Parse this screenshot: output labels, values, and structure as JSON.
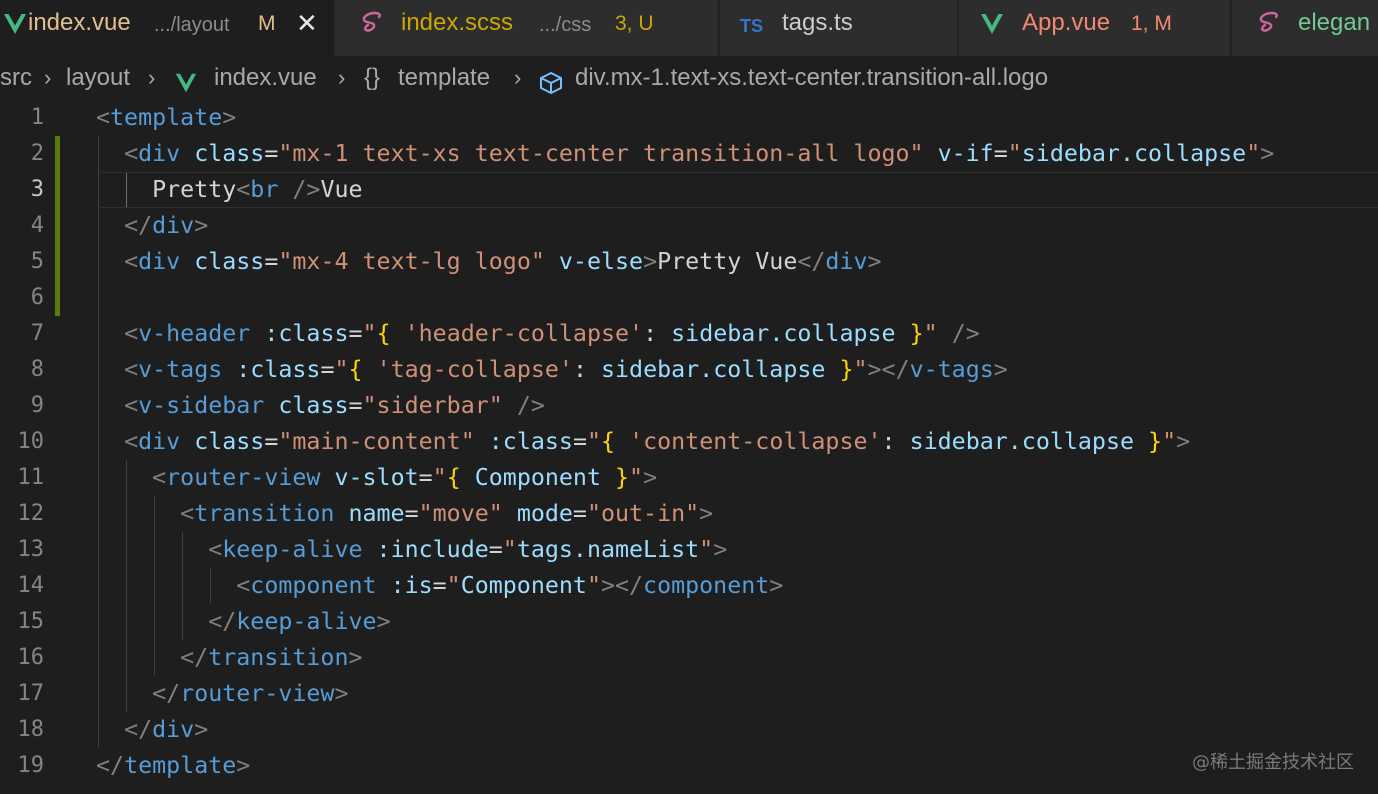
{
  "tabs": [
    {
      "name": "index.vue",
      "desc": ".../layout",
      "status": "M",
      "icon": "vue-icon",
      "active": true,
      "close": "✕",
      "name_color": "#e2c08d",
      "status_color": "#e2c08d"
    },
    {
      "name": "index.scss",
      "desc": ".../css",
      "status": "3, U",
      "icon": "sass-icon",
      "active": false,
      "name_color": "#cca700",
      "status_color": "#cca700"
    },
    {
      "name": "tags.ts",
      "desc": "",
      "status": "",
      "icon": "typescript-icon",
      "icon_text": "TS",
      "active": false,
      "name_color": "#cccccc"
    },
    {
      "name": "App.vue",
      "desc": "",
      "status": "1, M",
      "icon": "vue-icon",
      "active": false,
      "name_color": "#f48771",
      "status_color": "#f48771"
    },
    {
      "name": "elegan",
      "desc": "",
      "status": "",
      "icon": "sass-icon",
      "active": false,
      "name_color": "#73c991"
    }
  ],
  "breadcrumb": {
    "items": [
      "src",
      "layout",
      "index.vue",
      "template",
      "div.mx-1.text-xs.text-center.transition-all.logo"
    ],
    "template_icon": "{}",
    "separator": "›"
  },
  "editor": {
    "current_line": 3,
    "lines": [
      {
        "n": "1",
        "tokens": [
          [
            "t-punc",
            "<"
          ],
          [
            "t-tag",
            "template"
          ],
          [
            "t-punc",
            ">"
          ]
        ]
      },
      {
        "n": "2",
        "tokens": [
          [
            "t-text",
            "  "
          ],
          [
            "t-punc",
            "<"
          ],
          [
            "t-tag",
            "div"
          ],
          [
            "t-text",
            " "
          ],
          [
            "t-attr",
            "class"
          ],
          [
            "t-text",
            "="
          ],
          [
            "t-str",
            "\"mx-1 text-xs text-center transition-all logo\""
          ],
          [
            "t-text",
            " "
          ],
          [
            "t-attr",
            "v-if"
          ],
          [
            "t-text",
            "="
          ],
          [
            "t-str",
            "\""
          ],
          [
            "t-attr",
            "sidebar.collapse"
          ],
          [
            "t-str",
            "\""
          ],
          [
            "t-punc",
            ">"
          ]
        ]
      },
      {
        "n": "3",
        "tokens": [
          [
            "t-text",
            "    Pretty"
          ],
          [
            "t-punc",
            "<"
          ],
          [
            "t-tag",
            "br"
          ],
          [
            "t-text",
            " "
          ],
          [
            "t-punc",
            "/>"
          ],
          [
            "t-text",
            "Vue"
          ]
        ]
      },
      {
        "n": "4",
        "tokens": [
          [
            "t-text",
            "  "
          ],
          [
            "t-punc",
            "</"
          ],
          [
            "t-tag",
            "div"
          ],
          [
            "t-punc",
            ">"
          ]
        ]
      },
      {
        "n": "5",
        "tokens": [
          [
            "t-text",
            "  "
          ],
          [
            "t-punc",
            "<"
          ],
          [
            "t-tag",
            "div"
          ],
          [
            "t-text",
            " "
          ],
          [
            "t-attr",
            "class"
          ],
          [
            "t-text",
            "="
          ],
          [
            "t-str",
            "\"mx-4 text-lg logo\""
          ],
          [
            "t-text",
            " "
          ],
          [
            "t-attr",
            "v-else"
          ],
          [
            "t-punc",
            ">"
          ],
          [
            "t-text",
            "Pretty Vue"
          ],
          [
            "t-punc",
            "</"
          ],
          [
            "t-tag",
            "div"
          ],
          [
            "t-punc",
            ">"
          ]
        ]
      },
      {
        "n": "6",
        "tokens": []
      },
      {
        "n": "7",
        "tokens": [
          [
            "t-text",
            "  "
          ],
          [
            "t-punc",
            "<"
          ],
          [
            "t-tag",
            "v-header"
          ],
          [
            "t-text",
            " "
          ],
          [
            "t-attr",
            ":class"
          ],
          [
            "t-text",
            "="
          ],
          [
            "t-str",
            "\""
          ],
          [
            "t-brace",
            "{"
          ],
          [
            "t-text",
            " "
          ],
          [
            "t-str",
            "'header-collapse'"
          ],
          [
            "t-text",
            ": "
          ],
          [
            "t-attr",
            "sidebar.collapse"
          ],
          [
            "t-text",
            " "
          ],
          [
            "t-brace",
            "}"
          ],
          [
            "t-str",
            "\""
          ],
          [
            "t-text",
            " "
          ],
          [
            "t-punc",
            "/>"
          ]
        ]
      },
      {
        "n": "8",
        "tokens": [
          [
            "t-text",
            "  "
          ],
          [
            "t-punc",
            "<"
          ],
          [
            "t-tag",
            "v-tags"
          ],
          [
            "t-text",
            " "
          ],
          [
            "t-attr",
            ":class"
          ],
          [
            "t-text",
            "="
          ],
          [
            "t-str",
            "\""
          ],
          [
            "t-brace",
            "{"
          ],
          [
            "t-text",
            " "
          ],
          [
            "t-str",
            "'tag-collapse'"
          ],
          [
            "t-text",
            ": "
          ],
          [
            "t-attr",
            "sidebar.collapse"
          ],
          [
            "t-text",
            " "
          ],
          [
            "t-brace",
            "}"
          ],
          [
            "t-str",
            "\""
          ],
          [
            "t-punc",
            "></"
          ],
          [
            "t-tag",
            "v-tags"
          ],
          [
            "t-punc",
            ">"
          ]
        ]
      },
      {
        "n": "9",
        "tokens": [
          [
            "t-text",
            "  "
          ],
          [
            "t-punc",
            "<"
          ],
          [
            "t-tag",
            "v-sidebar"
          ],
          [
            "t-text",
            " "
          ],
          [
            "t-attr",
            "class"
          ],
          [
            "t-text",
            "="
          ],
          [
            "t-str",
            "\"siderbar\""
          ],
          [
            "t-text",
            " "
          ],
          [
            "t-punc",
            "/>"
          ]
        ]
      },
      {
        "n": "10",
        "tokens": [
          [
            "t-text",
            "  "
          ],
          [
            "t-punc",
            "<"
          ],
          [
            "t-tag",
            "div"
          ],
          [
            "t-text",
            " "
          ],
          [
            "t-attr",
            "class"
          ],
          [
            "t-text",
            "="
          ],
          [
            "t-str",
            "\"main-content\""
          ],
          [
            "t-text",
            " "
          ],
          [
            "t-attr",
            ":class"
          ],
          [
            "t-text",
            "="
          ],
          [
            "t-str",
            "\""
          ],
          [
            "t-brace",
            "{"
          ],
          [
            "t-text",
            " "
          ],
          [
            "t-str",
            "'content-collapse'"
          ],
          [
            "t-text",
            ": "
          ],
          [
            "t-attr",
            "sidebar.collapse"
          ],
          [
            "t-text",
            " "
          ],
          [
            "t-brace",
            "}"
          ],
          [
            "t-str",
            "\""
          ],
          [
            "t-punc",
            ">"
          ]
        ]
      },
      {
        "n": "11",
        "tokens": [
          [
            "t-text",
            "    "
          ],
          [
            "t-punc",
            "<"
          ],
          [
            "t-tag",
            "router-view"
          ],
          [
            "t-text",
            " "
          ],
          [
            "t-attr",
            "v-slot"
          ],
          [
            "t-text",
            "="
          ],
          [
            "t-str",
            "\""
          ],
          [
            "t-brace",
            "{"
          ],
          [
            "t-text",
            " "
          ],
          [
            "t-attr",
            "Component"
          ],
          [
            "t-text",
            " "
          ],
          [
            "t-brace",
            "}"
          ],
          [
            "t-str",
            "\""
          ],
          [
            "t-punc",
            ">"
          ]
        ]
      },
      {
        "n": "12",
        "tokens": [
          [
            "t-text",
            "      "
          ],
          [
            "t-punc",
            "<"
          ],
          [
            "t-tag",
            "transition"
          ],
          [
            "t-text",
            " "
          ],
          [
            "t-attr",
            "name"
          ],
          [
            "t-text",
            "="
          ],
          [
            "t-str",
            "\"move\""
          ],
          [
            "t-text",
            " "
          ],
          [
            "t-attr",
            "mode"
          ],
          [
            "t-text",
            "="
          ],
          [
            "t-str",
            "\"out-in\""
          ],
          [
            "t-punc",
            ">"
          ]
        ]
      },
      {
        "n": "13",
        "tokens": [
          [
            "t-text",
            "        "
          ],
          [
            "t-punc",
            "<"
          ],
          [
            "t-tag",
            "keep-alive"
          ],
          [
            "t-text",
            " "
          ],
          [
            "t-attr",
            ":include"
          ],
          [
            "t-text",
            "="
          ],
          [
            "t-str",
            "\""
          ],
          [
            "t-attr",
            "tags.nameList"
          ],
          [
            "t-str",
            "\""
          ],
          [
            "t-punc",
            ">"
          ]
        ]
      },
      {
        "n": "14",
        "tokens": [
          [
            "t-text",
            "          "
          ],
          [
            "t-punc",
            "<"
          ],
          [
            "t-tag",
            "component"
          ],
          [
            "t-text",
            " "
          ],
          [
            "t-attr",
            ":is"
          ],
          [
            "t-text",
            "="
          ],
          [
            "t-str",
            "\""
          ],
          [
            "t-attr",
            "Component"
          ],
          [
            "t-str",
            "\""
          ],
          [
            "t-punc",
            "></"
          ],
          [
            "t-tag",
            "component"
          ],
          [
            "t-punc",
            ">"
          ]
        ]
      },
      {
        "n": "15",
        "tokens": [
          [
            "t-text",
            "        "
          ],
          [
            "t-punc",
            "</"
          ],
          [
            "t-tag",
            "keep-alive"
          ],
          [
            "t-punc",
            ">"
          ]
        ]
      },
      {
        "n": "16",
        "tokens": [
          [
            "t-text",
            "      "
          ],
          [
            "t-punc",
            "</"
          ],
          [
            "t-tag",
            "transition"
          ],
          [
            "t-punc",
            ">"
          ]
        ]
      },
      {
        "n": "17",
        "tokens": [
          [
            "t-text",
            "    "
          ],
          [
            "t-punc",
            "</"
          ],
          [
            "t-tag",
            "router-view"
          ],
          [
            "t-punc",
            ">"
          ]
        ]
      },
      {
        "n": "18",
        "tokens": [
          [
            "t-text",
            "  "
          ],
          [
            "t-punc",
            "</"
          ],
          [
            "t-tag",
            "div"
          ],
          [
            "t-punc",
            ">"
          ]
        ]
      },
      {
        "n": "19",
        "tokens": [
          [
            "t-punc",
            "</"
          ],
          [
            "t-tag",
            "template"
          ],
          [
            "t-punc",
            ">"
          ]
        ]
      }
    ]
  },
  "watermark": "@稀土掘金技术社区",
  "colors": {
    "vue_green": "#42b883",
    "sass_pink": "#cd6799",
    "ts_blue": "#3178c6",
    "modified_bar": "#587c0c"
  }
}
